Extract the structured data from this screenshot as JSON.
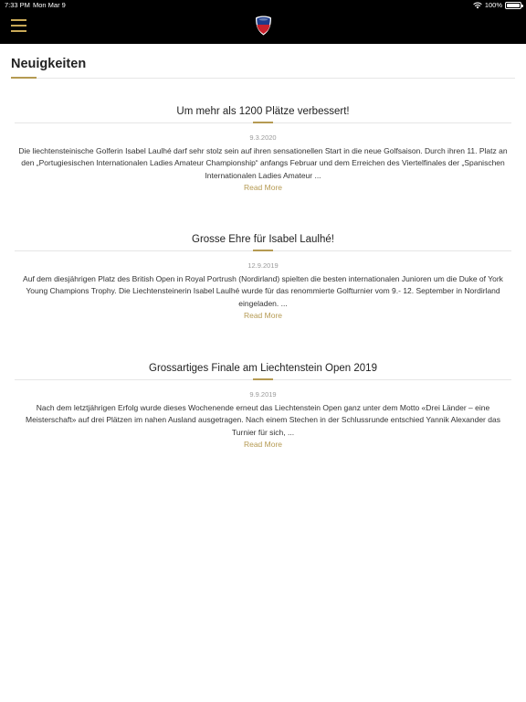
{
  "status_bar": {
    "time": "7:33 PM",
    "date": "Mon Mar 9",
    "battery": "100%"
  },
  "nav": {
    "menu_icon": "hamburger-menu-icon",
    "logo_icon": "shield-logo-icon"
  },
  "colors": {
    "accent": "#b59a52",
    "topbar": "#000000"
  },
  "page": {
    "title": "Neuigkeiten"
  },
  "articles": [
    {
      "title": "Um mehr als 1200 Plätze verbessert!",
      "date": "9.3.2020",
      "excerpt": "Die liechtensteinische Golferin Isabel Laulhé darf sehr stolz sein auf ihren sensationellen Start in die neue Golfsaison. Durch ihren 11. Platz an den „Portugiesischen Internationalen Ladies Amateur Championship“ anfangs Februar und dem Erreichen des Viertelfinales der „Spanischen Internationalen Ladies Amateur ...",
      "read_more": "Read More"
    },
    {
      "title": "Grosse Ehre für Isabel Laulhé!",
      "date": "12.9.2019",
      "excerpt": "Auf dem diesjährigen Platz des British Open in Royal Portrush (Nordirland) spielten die besten internationalen Junioren um die Duke of York Young Champions Trophy. Die Liechtensteinerin Isabel Laulhé wurde für das renommierte Golfturnier vom 9.- 12. September in Nordirland eingeladen. ...",
      "read_more": "Read More"
    },
    {
      "title": "Grossartiges Finale am Liechtenstein Open 2019",
      "date": "9.9.2019",
      "excerpt": "Nach dem letztjährigen Erfolg wurde dieses Wochenende erneut das Liechtenstein Open ganz unter dem Motto «Drei Länder – eine Meisterschaft» auf drei Plätzen im nahen Ausland ausgetragen. Nach einem Stechen in der Schlussrunde entschied Yannik Alexander das Turnier für sich, ...",
      "read_more": "Read More"
    }
  ]
}
